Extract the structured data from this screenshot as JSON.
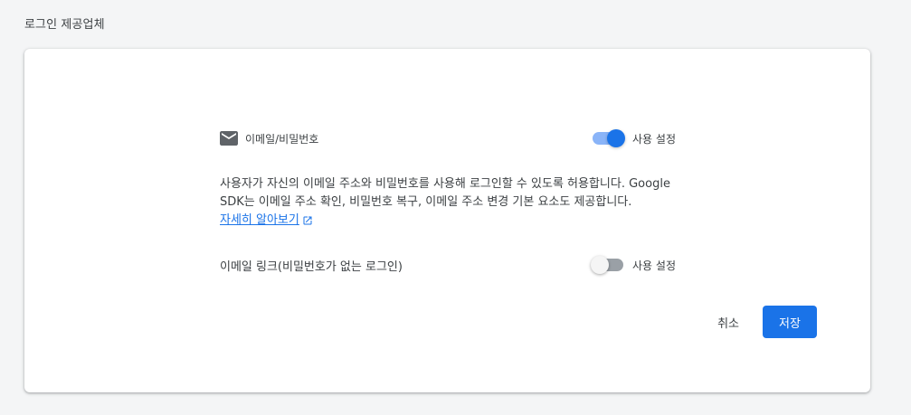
{
  "header": {
    "title": "로그인 제공업체"
  },
  "providers": {
    "email_password": {
      "icon": "mail-icon",
      "label": "이메일/비밀번호",
      "enabled": true,
      "toggle_label": "사용 설정",
      "description": "사용자가 자신의 이메일 주소와 비밀번호를 사용해 로그인할 수 있도록 허용합니다. Google SDK는 이메일 주소 확인, 비밀번호 복구, 이메일 주소 변경 기본 요소도 제공합니다.",
      "learn_more": "자세히 알아보기",
      "learn_more_icon": "external-link-icon"
    },
    "email_link": {
      "label": "이메일 링크(비밀번호가 없는 로그인)",
      "enabled": false,
      "toggle_label": "사용 설정"
    }
  },
  "actions": {
    "cancel_label": "취소",
    "save_label": "저장"
  },
  "colors": {
    "accent": "#1a73e8",
    "accent_light": "#8ab4f8",
    "background": "#f4f5f6"
  }
}
